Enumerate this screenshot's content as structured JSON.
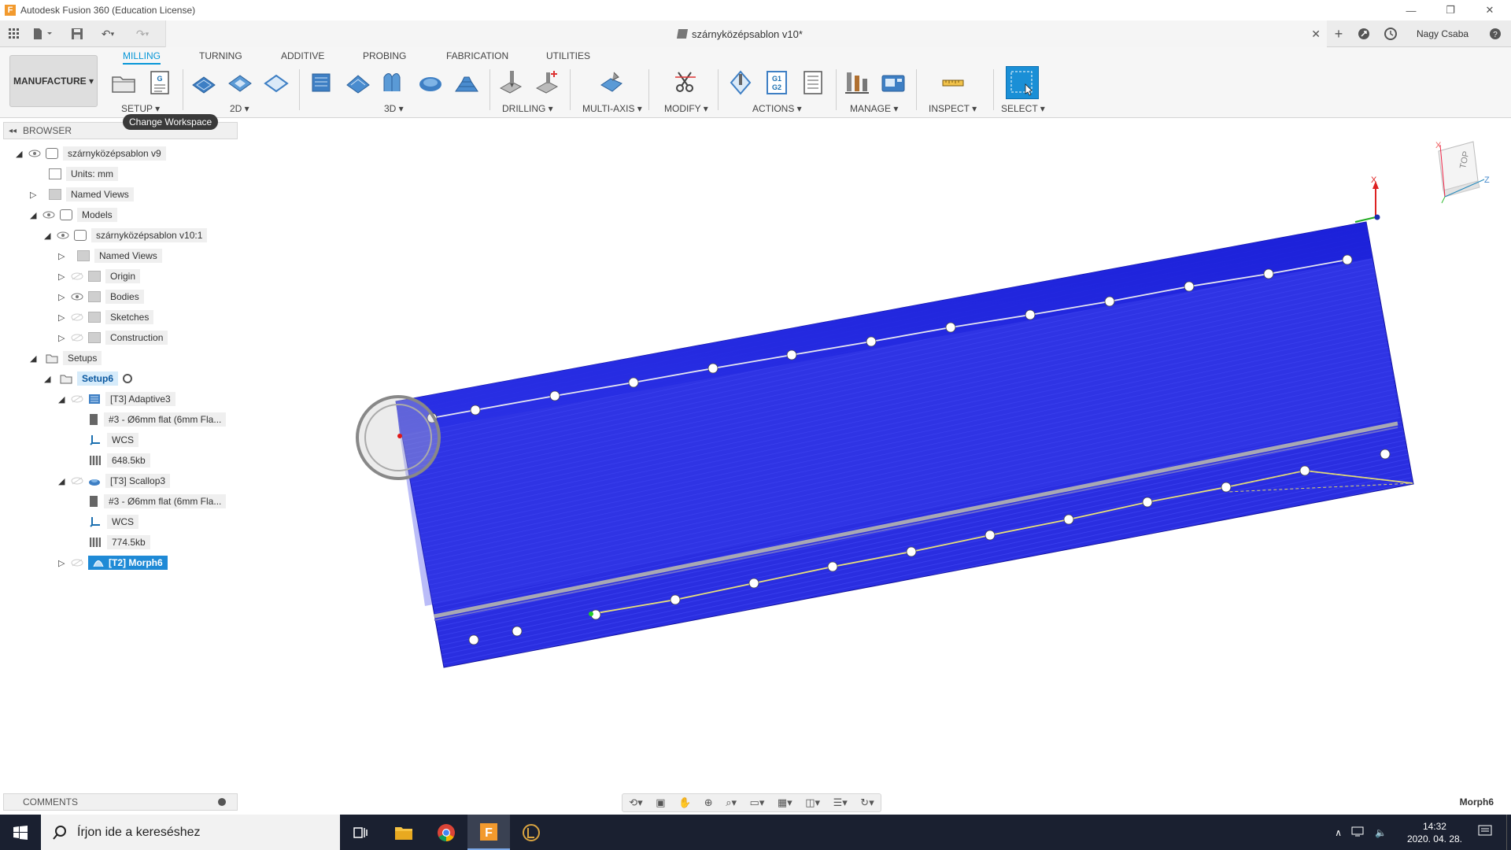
{
  "app": {
    "title": "Autodesk Fusion 360 (Education License)",
    "icon": "F"
  },
  "document": {
    "title": "szárnyközépsablon v10*"
  },
  "user": {
    "name": "Nagy Csaba"
  },
  "ribbon": {
    "workspace_label": "MANUFACTURE ▾",
    "tabs": [
      "MILLING",
      "TURNING",
      "ADDITIVE",
      "PROBING",
      "FABRICATION",
      "UTILITIES"
    ],
    "active_tab": "MILLING",
    "groups": {
      "setup": "SETUP ▾",
      "two_d": "2D ▾",
      "three_d": "3D ▾",
      "drilling": "DRILLING ▾",
      "multi_axis": "MULTI-AXIS ▾",
      "modify": "MODIFY ▾",
      "actions": "ACTIONS ▾",
      "manage": "MANAGE ▾",
      "inspect": "INSPECT ▾",
      "select": "SELECT ▾"
    },
    "tooltip": "Change Workspace",
    "gcode_icon_text": "G1\nG2"
  },
  "browser": {
    "title": "BROWSER",
    "rows": [
      {
        "label": "szárnyközépsablon v9"
      },
      {
        "label": "Units: mm"
      },
      {
        "label": "Named Views"
      },
      {
        "label": "Models"
      },
      {
        "label": "szárnyközépsablon v10:1"
      },
      {
        "label": "Named Views"
      },
      {
        "label": "Origin"
      },
      {
        "label": "Bodies"
      },
      {
        "label": "Sketches"
      },
      {
        "label": "Construction"
      },
      {
        "label": "Setups"
      },
      {
        "label": "Setup6"
      },
      {
        "label": "[T3] Adaptive3"
      },
      {
        "label": "#3 - Ø6mm flat (6mm Fla..."
      },
      {
        "label": "WCS"
      },
      {
        "label": "648.5kb"
      },
      {
        "label": "[T3] Scallop3"
      },
      {
        "label": "#3 - Ø6mm flat (6mm Fla..."
      },
      {
        "label": "WCS"
      },
      {
        "label": "774.5kb"
      },
      {
        "label": "[T2] Morph6"
      }
    ]
  },
  "viewcube": {
    "face": "TOP",
    "x_label": "X",
    "z_label": "Z"
  },
  "triad": {
    "x_label": "X"
  },
  "comments": {
    "title": "COMMENTS"
  },
  "status": {
    "selection": "Morph6"
  },
  "taskbar": {
    "search_placeholder": "Írjon ide a kereséshez",
    "time": "14:32",
    "date": "2020. 04. 28."
  },
  "colors": {
    "part_blue": "#2a2ee0",
    "accent": "#0696d7",
    "toolpath_yellow": "#e8e07a"
  }
}
